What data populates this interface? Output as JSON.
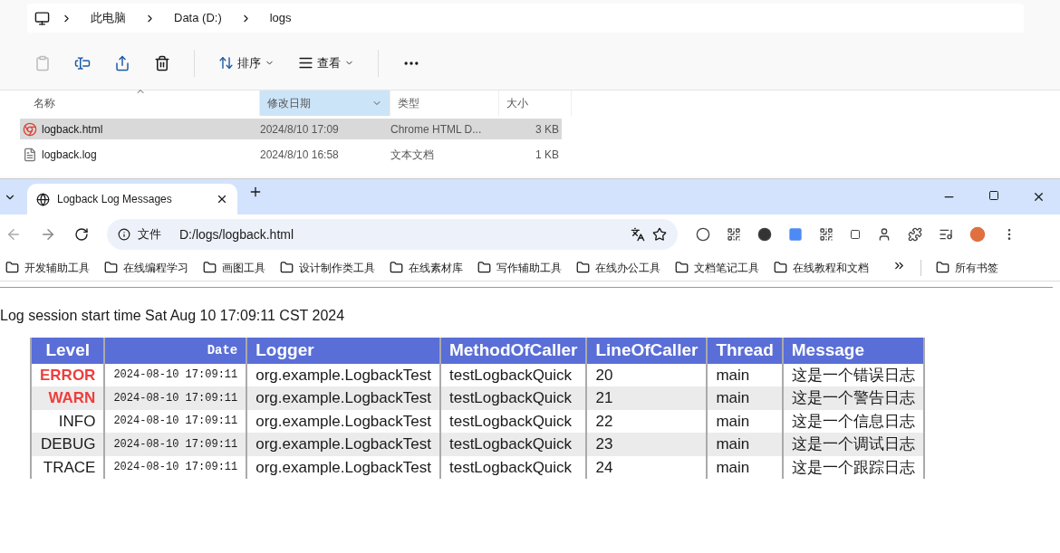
{
  "explorer": {
    "breadcrumb": [
      "此电脑",
      "Data (D:)",
      "logs"
    ],
    "toolbar": {
      "sort": "排序",
      "view": "查看"
    },
    "columns": [
      {
        "label": "名称",
        "selected": false,
        "sorted": true
      },
      {
        "label": "修改日期",
        "selected": true,
        "sorted": false
      },
      {
        "label": "类型",
        "selected": false,
        "sorted": false
      },
      {
        "label": "大小",
        "selected": false,
        "sorted": false
      }
    ],
    "files": [
      {
        "kind": "html",
        "name": "logback.html",
        "modified": "2024/8/10 17:09",
        "type": "Chrome HTML D...",
        "size": "3 KB",
        "selected": true
      },
      {
        "kind": "text",
        "name": "logback.log",
        "modified": "2024/8/10 16:58",
        "type": "文本文档",
        "size": "1 KB",
        "selected": false
      }
    ]
  },
  "browser": {
    "tab_title": "Logback Log Messages",
    "url_chip": "文件",
    "url": "D:/logs/logback.html",
    "bookmarks": [
      "开发辅助工具",
      "在线编程学习",
      "画图工具",
      "设计制作类工具",
      "在线素材库",
      "写作辅助工具",
      "在线办公工具",
      "文档笔记工具",
      "在线教程和文档"
    ],
    "all_bookmarks": "所有书签"
  },
  "page": {
    "session": "Log session start time Sat Aug 10 17:09:11 CST 2024",
    "columns": [
      "Level",
      "Date",
      "Logger",
      "MethodOfCaller",
      "LineOfCaller",
      "Thread",
      "Message"
    ],
    "rows": [
      {
        "level": "ERROR",
        "highlight": true,
        "date": "2024-08-10 17:09:11",
        "logger": "org.example.LogbackTest",
        "method": "testLogbackQuick",
        "line": "20",
        "thread": "main",
        "message": "这是一个错误日志"
      },
      {
        "level": "WARN",
        "highlight": true,
        "date": "2024-08-10 17:09:11",
        "logger": "org.example.LogbackTest",
        "method": "testLogbackQuick",
        "line": "21",
        "thread": "main",
        "message": "这是一个警告日志"
      },
      {
        "level": "INFO",
        "highlight": false,
        "date": "2024-08-10 17:09:11",
        "logger": "org.example.LogbackTest",
        "method": "testLogbackQuick",
        "line": "22",
        "thread": "main",
        "message": "这是一个信息日志"
      },
      {
        "level": "DEBUG",
        "highlight": false,
        "date": "2024-08-10 17:09:11",
        "logger": "org.example.LogbackTest",
        "method": "testLogbackQuick",
        "line": "23",
        "thread": "main",
        "message": "这是一个调试日志"
      },
      {
        "level": "TRACE",
        "highlight": false,
        "date": "2024-08-10 17:09:11",
        "logger": "org.example.LogbackTest",
        "method": "testLogbackQuick",
        "line": "24",
        "thread": "main",
        "message": "这是一个跟踪日志"
      }
    ]
  }
}
